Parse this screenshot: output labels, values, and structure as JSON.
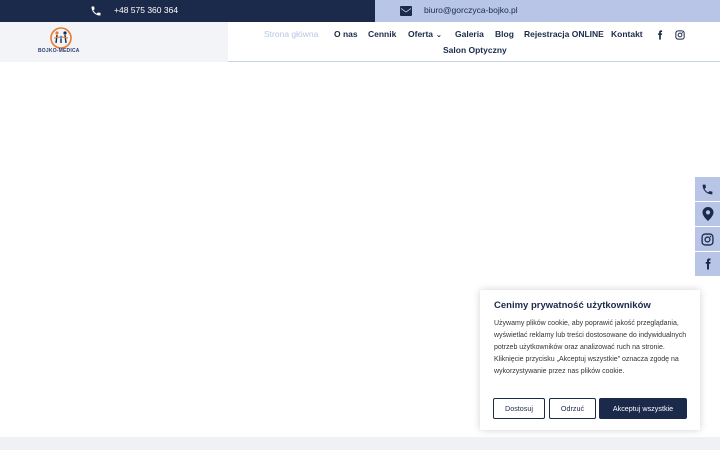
{
  "topbar": {
    "phone": "+48 575 360 364",
    "email": "biuro@gorczyca-bojko.pl",
    "phone_icon": "phone-icon",
    "mail_icon": "envelope-icon"
  },
  "logo": {
    "name": "BOJKO-MEDICA",
    "icon": "family-logo-icon"
  },
  "nav": {
    "items": [
      {
        "label": "Strona główna",
        "active": true
      },
      {
        "label": "O nas"
      },
      {
        "label": "Cennik"
      },
      {
        "label": "Oferta",
        "dropdown": true
      },
      {
        "label": "Galeria"
      },
      {
        "label": "Blog"
      },
      {
        "label": "Rejestracja ONLINE"
      },
      {
        "label": "Kontakt"
      },
      {
        "label": "Salon Optyczny"
      }
    ],
    "social": [
      "facebook-icon",
      "instagram-icon"
    ]
  },
  "side_buttons": [
    "phone-icon",
    "map-pin-icon",
    "instagram-icon",
    "facebook-icon"
  ],
  "cookie": {
    "title": "Cenimy prywatność użytkowników",
    "text": "Używamy plików cookie, aby poprawić jakość przeglądania, wyświetlać reklamy lub treści dostosowane do indywidualnych potrzeb użytkowników oraz analizować ruch na stronie. Kliknięcie przycisku „Akceptuj wszystkie” oznacza zgodę na wykorzystywanie przez nas plików cookie.",
    "btn_customize": "Dostosuj",
    "btn_reject": "Odrzuć",
    "btn_accept": "Akceptuj wszystkie"
  },
  "colors": {
    "navy": "#1b2a4a",
    "accent": "#b8c5e6"
  }
}
